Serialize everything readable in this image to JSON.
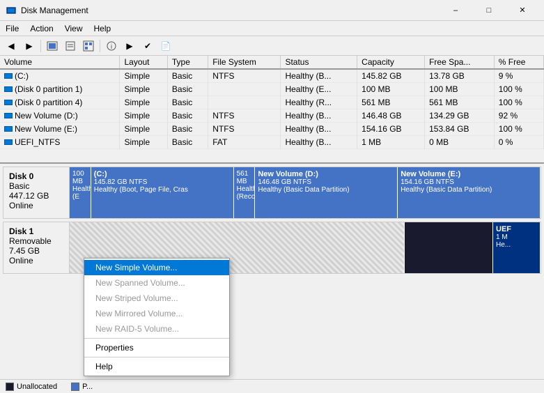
{
  "titleBar": {
    "title": "Disk Management",
    "minimize": "–",
    "maximize": "□",
    "close": "✕"
  },
  "menuBar": {
    "items": [
      "File",
      "Action",
      "View",
      "Help"
    ]
  },
  "toolbar": {
    "buttons": [
      "←",
      "→",
      "⬛",
      "📋",
      "⬛",
      "🔑",
      "⬛",
      "▶",
      "✔",
      "📄"
    ]
  },
  "table": {
    "columns": [
      "Volume",
      "Layout",
      "Type",
      "File System",
      "Status",
      "Capacity",
      "Free Spa...",
      "% Free"
    ],
    "rows": [
      {
        "volume": "(C:)",
        "layout": "Simple",
        "type": "Basic",
        "fs": "NTFS",
        "status": "Healthy (B...",
        "capacity": "145.82 GB",
        "free": "13.78 GB",
        "pct": "9 %"
      },
      {
        "volume": "(Disk 0 partition 1)",
        "layout": "Simple",
        "type": "Basic",
        "fs": "",
        "status": "Healthy (E...",
        "capacity": "100 MB",
        "free": "100 MB",
        "pct": "100 %"
      },
      {
        "volume": "(Disk 0 partition 4)",
        "layout": "Simple",
        "type": "Basic",
        "fs": "",
        "status": "Healthy (R...",
        "capacity": "561 MB",
        "free": "561 MB",
        "pct": "100 %"
      },
      {
        "volume": "New Volume (D:)",
        "layout": "Simple",
        "type": "Basic",
        "fs": "NTFS",
        "status": "Healthy (B...",
        "capacity": "146.48 GB",
        "free": "134.29 GB",
        "pct": "92 %"
      },
      {
        "volume": "New Volume (E:)",
        "layout": "Simple",
        "type": "Basic",
        "fs": "NTFS",
        "status": "Healthy (B...",
        "capacity": "154.16 GB",
        "free": "153.84 GB",
        "pct": "100 %"
      },
      {
        "volume": "UEFI_NTFS",
        "layout": "Simple",
        "type": "Basic",
        "fs": "FAT",
        "status": "Healthy (B...",
        "capacity": "1 MB",
        "free": "0 MB",
        "pct": "0 %"
      }
    ]
  },
  "disks": [
    {
      "name": "Disk 0",
      "type": "Basic",
      "size": "447.12 GB",
      "status": "Online",
      "partitions": [
        {
          "label": "",
          "size": "100 MB",
          "detail": "Healthy (E",
          "colorClass": "partition-blue",
          "flex": "1"
        },
        {
          "label": "(C:)",
          "size": "145.82 GB NTFS",
          "detail": "Healthy (Boot, Page File, Cras",
          "colorClass": "partition-blue",
          "flex": "9"
        },
        {
          "label": "",
          "size": "561 MB",
          "detail": "Healthy (Reco",
          "colorClass": "partition-blue",
          "flex": "1"
        },
        {
          "label": "New Volume  (D:)",
          "size": "146.48 GB NTFS",
          "detail": "Healthy (Basic Data Partition)",
          "colorClass": "partition-blue",
          "flex": "9"
        },
        {
          "label": "New Volume  (E:)",
          "size": "154.16 GB NTFS",
          "detail": "Healthy (Basic Data Partition)",
          "colorClass": "partition-blue",
          "flex": "9"
        }
      ]
    },
    {
      "name": "Disk 1",
      "type": "Removable",
      "size": "7.45 GB",
      "status": "Online",
      "partitions": [
        {
          "label": "",
          "size": "",
          "detail": "",
          "colorClass": "partition-striped",
          "flex": "8"
        },
        {
          "label": "",
          "size": "",
          "detail": "",
          "colorClass": "partition-black",
          "flex": "2"
        },
        {
          "label": "UEF",
          "size": "1 M",
          "detail": "He...",
          "colorClass": "partition-navy",
          "flex": "1"
        }
      ]
    }
  ],
  "contextMenu": {
    "items": [
      {
        "label": "New Simple Volume...",
        "highlighted": true,
        "disabled": false
      },
      {
        "label": "New Spanned Volume...",
        "highlighted": false,
        "disabled": true
      },
      {
        "label": "New Striped Volume...",
        "highlighted": false,
        "disabled": true
      },
      {
        "label": "New Mirrored Volume...",
        "highlighted": false,
        "disabled": true
      },
      {
        "label": "New RAID-5 Volume...",
        "highlighted": false,
        "disabled": true
      },
      {
        "separator": true
      },
      {
        "label": "Properties",
        "highlighted": false,
        "disabled": false
      },
      {
        "separator": true
      },
      {
        "label": "Help",
        "highlighted": false,
        "disabled": false
      }
    ]
  },
  "statusBar": {
    "legends": [
      {
        "label": "Unallocated",
        "color": "#1a1a2e"
      },
      {
        "label": "P...",
        "color": "#4472c4"
      }
    ]
  }
}
